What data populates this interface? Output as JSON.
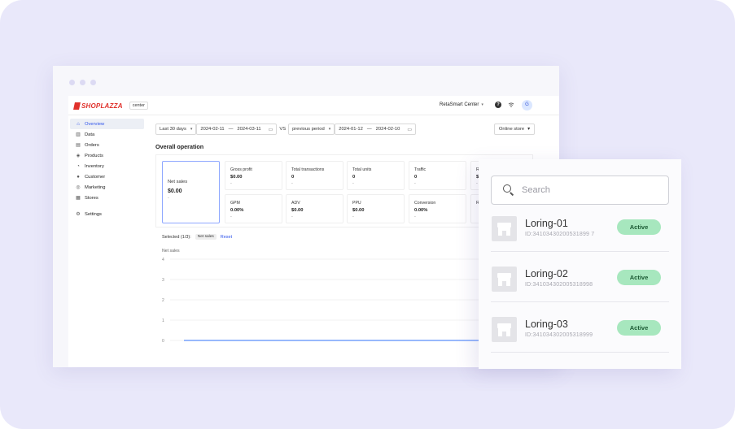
{
  "brand": {
    "logo": "SHOPLAZZA",
    "sub": "center"
  },
  "topbar": {
    "store_name": "RetaSmart Center",
    "avatar": "G"
  },
  "sidebar": {
    "items": [
      {
        "label": "Overview",
        "icon": "home-icon",
        "active": true
      },
      {
        "label": "Data",
        "icon": "bar-chart-icon"
      },
      {
        "label": "Orders",
        "icon": "inbox-icon"
      },
      {
        "label": "Products",
        "icon": "tag-icon"
      },
      {
        "label": "Inventory",
        "icon": "inventory-icon"
      },
      {
        "label": "Customer",
        "icon": "person-icon"
      },
      {
        "label": "Marketing",
        "icon": "target-icon"
      },
      {
        "label": "Stores",
        "icon": "store-icon"
      }
    ],
    "settings": {
      "label": "Settings",
      "icon": "gear-icon"
    }
  },
  "filters": {
    "period": "Last 30 days",
    "start": "2024-02-11",
    "end": "2024-03-11",
    "sep": "—",
    "vs": "VS",
    "compare": "previous period",
    "cstart": "2024-01-12",
    "cend": "2024-02-10",
    "channel": "Online store"
  },
  "section_title": "Overall operation",
  "metrics": {
    "net_sales": {
      "label": "Net sales",
      "value": "$0.00",
      "delta": "-"
    },
    "cards": [
      {
        "label": "Gross profit",
        "value": "$0.00",
        "delta": "-"
      },
      {
        "label": "Total transactions",
        "value": "0",
        "delta": "-"
      },
      {
        "label": "Total units",
        "value": "0",
        "delta": "-"
      },
      {
        "label": "Traffic",
        "value": "0",
        "delta": "-"
      },
      {
        "label": "R",
        "value": "$",
        "delta": "-"
      },
      {
        "label": "GPM",
        "value": "0.00%",
        "delta": "-"
      },
      {
        "label": "ADV",
        "value": "$0.00",
        "delta": "-"
      },
      {
        "label": "PPU",
        "value": "$0.00",
        "delta": "-"
      },
      {
        "label": "Conversion",
        "value": "0.00%",
        "delta": "-"
      },
      {
        "label": "R",
        "value": "",
        "delta": ""
      }
    ]
  },
  "selection": {
    "label": "Selected (1/3):",
    "chip": "Net sales",
    "reset": "Reset"
  },
  "chart_data": {
    "type": "line",
    "title": "Net sales",
    "ylim": [
      0,
      4
    ],
    "yticks": [
      "4",
      "3",
      "2",
      "1",
      "0"
    ],
    "series": [
      {
        "values": [
          0,
          0
        ]
      }
    ],
    "grid": true,
    "color": "#5b8ff9"
  },
  "picker": {
    "search_placeholder": "Search",
    "stores": [
      {
        "name": "Loring-01",
        "id": "ID:34103430200531899 7",
        "status": "Active"
      },
      {
        "name": "Loring-02",
        "id": "ID:341034302005318998",
        "status": "Active"
      },
      {
        "name": "Loring-03",
        "id": "ID:341034302005318999",
        "status": "Active"
      }
    ]
  },
  "colors": {
    "background": "#e9e8fa",
    "accent": "#2f54eb",
    "brand": "#e0312b",
    "active_badge": "#a7e7be"
  }
}
